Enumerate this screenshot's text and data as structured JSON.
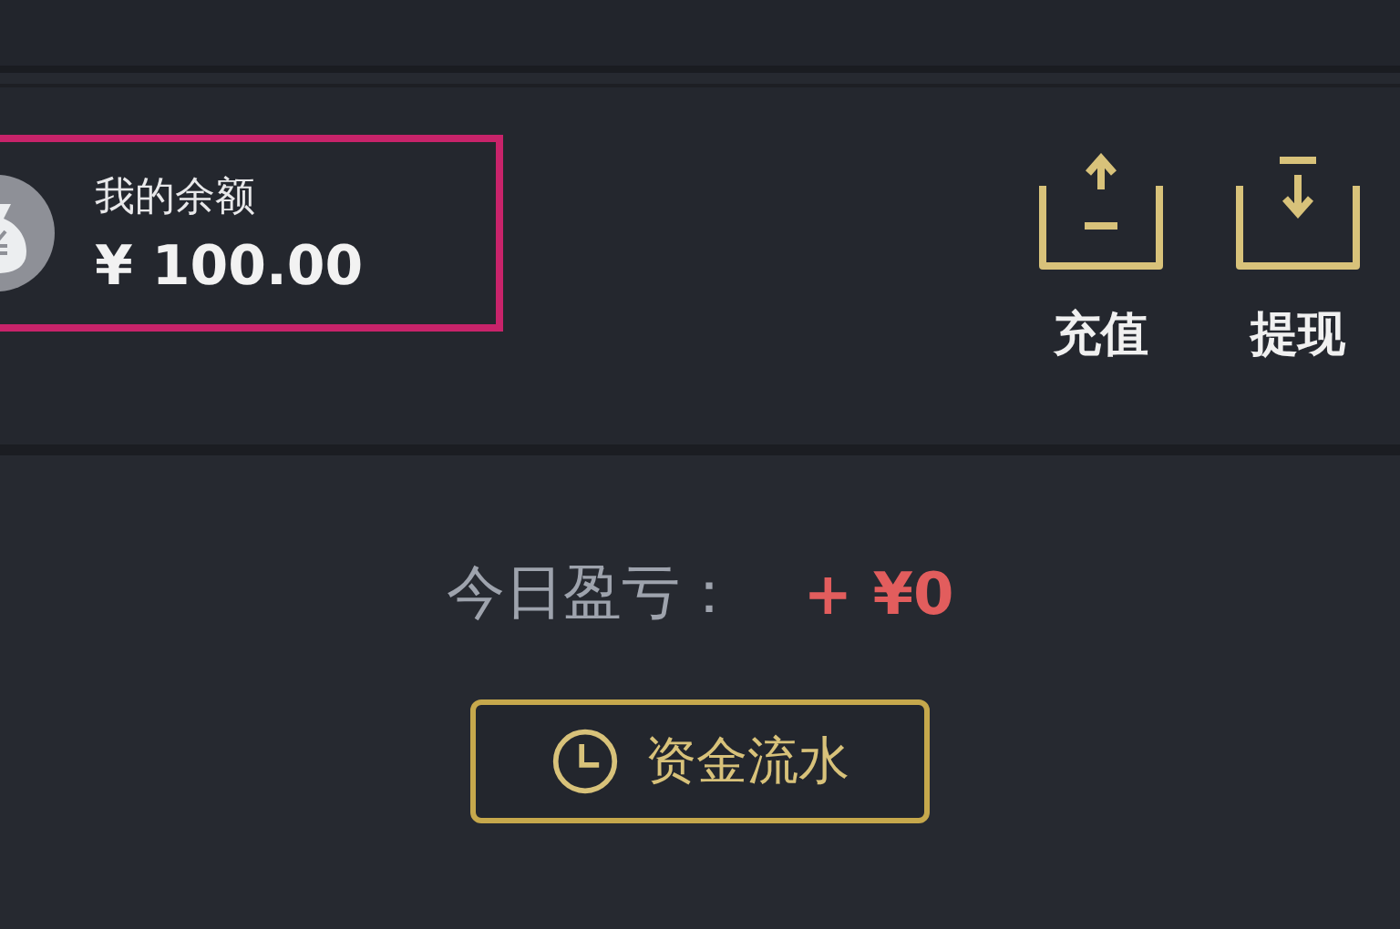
{
  "balance": {
    "label": "我的余额",
    "amount": "¥ 100.00"
  },
  "actions": [
    {
      "kind": "deposit",
      "label": "充值"
    },
    {
      "kind": "withdraw",
      "label": "提现"
    }
  ],
  "profit": {
    "label": "今日盈亏：",
    "value": "+ ¥0"
  },
  "flow_button": {
    "label": "资金流水"
  }
}
